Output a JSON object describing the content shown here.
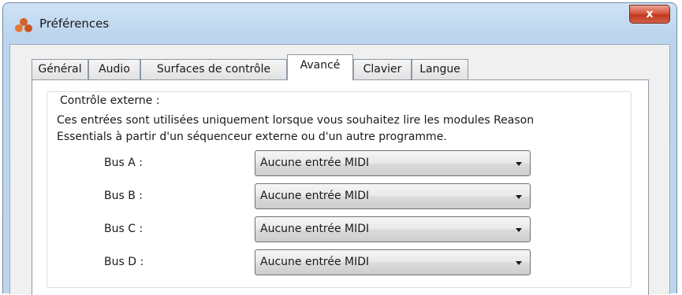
{
  "window": {
    "title": "Préférences",
    "close_label": "x"
  },
  "tabs": [
    {
      "label": "Général",
      "active": false
    },
    {
      "label": "Audio",
      "active": false
    },
    {
      "label": "Surfaces de contrôle",
      "active": false
    },
    {
      "label": "Avancé",
      "active": true
    },
    {
      "label": "Clavier",
      "active": false
    },
    {
      "label": "Langue",
      "active": false
    }
  ],
  "external_control": {
    "legend": "Contrôle externe :",
    "description_line1": "Ces entrées sont utilisées uniquement lorsque vous souhaitez lire les modules Reason",
    "description_line2": "Essentials à partir d'un séquenceur externe ou d'un autre programme.",
    "buses": [
      {
        "label": "Bus A :",
        "value": "Aucune entrée MIDI"
      },
      {
        "label": "Bus B :",
        "value": "Aucune entrée MIDI"
      },
      {
        "label": "Bus C :",
        "value": "Aucune entrée MIDI"
      },
      {
        "label": "Bus D :",
        "value": "Aucune entrée MIDI"
      }
    ]
  },
  "colors": {
    "title_bar": "#bcd5ee",
    "close_button": "#c0391f",
    "client_bg": "#f0f0f0",
    "panel_bg": "#ffffff"
  }
}
